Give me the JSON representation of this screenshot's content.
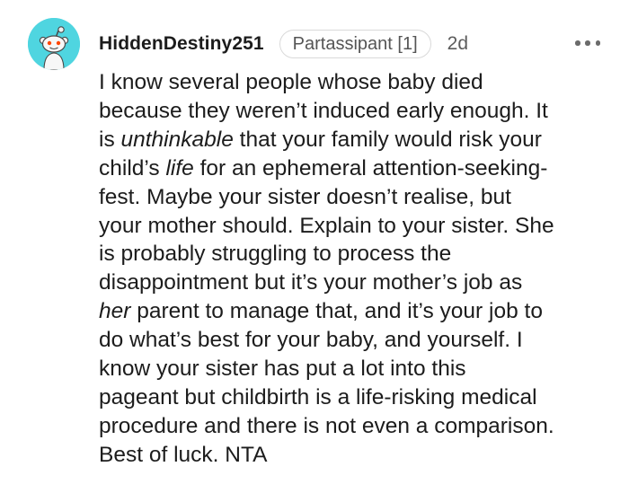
{
  "comment": {
    "username": "HiddenDestiny251",
    "flair": "Partassipant [1]",
    "age": "2d",
    "more_icon": "ellipsis-horizontal-icon",
    "avatar_icon": "reddit-snoo-avatar-icon",
    "avatar_color": "#4fd5e0",
    "lines": [
      [
        {
          "t": "I know several people whose baby died"
        }
      ],
      [
        {
          "t": "because they weren’t induced early enough. It"
        }
      ],
      [
        {
          "t": "is "
        },
        {
          "t": "unthinkable",
          "i": true
        },
        {
          "t": " that your family would risk your"
        }
      ],
      [
        {
          "t": "child’s "
        },
        {
          "t": "life",
          "i": true
        },
        {
          "t": " for an ephemeral attention-seeking-"
        }
      ],
      [
        {
          "t": "fest. Maybe your sister doesn’t realise, but"
        }
      ],
      [
        {
          "t": "your mother should. Explain to your sister. She"
        }
      ],
      [
        {
          "t": "is probably struggling to process the"
        }
      ],
      [
        {
          "t": "disappointment but it’s your mother’s job as"
        }
      ],
      [
        {
          "t": "her",
          "i": true
        },
        {
          "t": " parent to manage that, and it’s your job to"
        }
      ],
      [
        {
          "t": "do what’s best for your baby, and yourself. I"
        }
      ],
      [
        {
          "t": "know your sister has put a lot into this"
        }
      ],
      [
        {
          "t": "pageant but childbirth is a life-risking medical"
        }
      ],
      [
        {
          "t": "procedure and there is not even a comparison."
        }
      ],
      [
        {
          "t": "Best of luck. NTA"
        }
      ]
    ]
  }
}
